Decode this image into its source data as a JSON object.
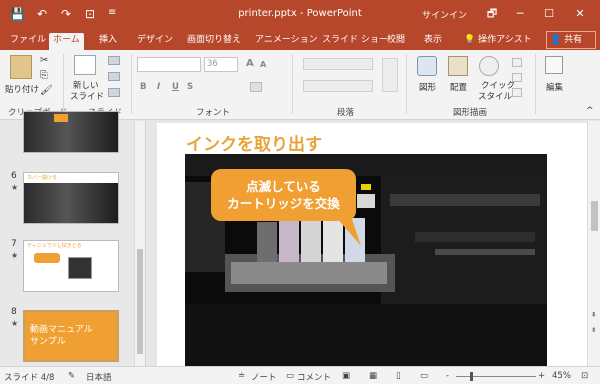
{
  "window": {
    "title": "printer.pptx - PowerPoint",
    "signin": "サインイン",
    "min": "─",
    "restore": "☐",
    "close": "✕",
    "restore_ribbon": "🗗"
  },
  "quick_access": {
    "save": "💾",
    "undo": "↶",
    "redo": "↷",
    "present": "⊡",
    "more": "≡"
  },
  "tabs": [
    "ファイル",
    "ホーム",
    "挿入",
    "デザイン",
    "画面切り替え",
    "アニメーション",
    "スライド ショー",
    "校閲",
    "表示"
  ],
  "tell_me": "💡 操作アシスト",
  "share": "共有",
  "ribbon": {
    "paste": "貼り付け",
    "new_slide_1": "新しい",
    "new_slide_2": "スライド",
    "font_size": "36",
    "shapes": "図形",
    "arrange": "配置",
    "quick_styles_1": "クイック",
    "quick_styles_2": "スタイル",
    "editing": "編集",
    "bold": "B",
    "italic": "I",
    "underline": "U",
    "strike": "S",
    "grow_font": "A",
    "shrink_font": "A",
    "groups": {
      "clipboard": "クリップボード",
      "slides": "スライド",
      "font": "フォント",
      "paragraph": "段落",
      "drawing": "図形描画"
    }
  },
  "thumbnails": [
    {
      "num": "6",
      "star": "★",
      "title": "カバー開ける"
    },
    {
      "num": "7",
      "star": "★",
      "title": "ティシュで少し拭きとる"
    },
    {
      "num": "8",
      "star": "★",
      "title": "動画マニュアル",
      "subtitle": "サンプル"
    }
  ],
  "slide": {
    "title": "インクを取り出す",
    "callout_line1": "点滅している",
    "callout_line2": "カートリッジを交換"
  },
  "status": {
    "slide_count": "スライド 4/8",
    "language": "日本語",
    "notes": "ノート",
    "comments": "コメント",
    "zoom": "45%",
    "minus": "-",
    "plus": "+"
  },
  "colors": {
    "accent": "#b7472a",
    "slide_title": "#e8a33a",
    "callout": "#f0a033"
  }
}
